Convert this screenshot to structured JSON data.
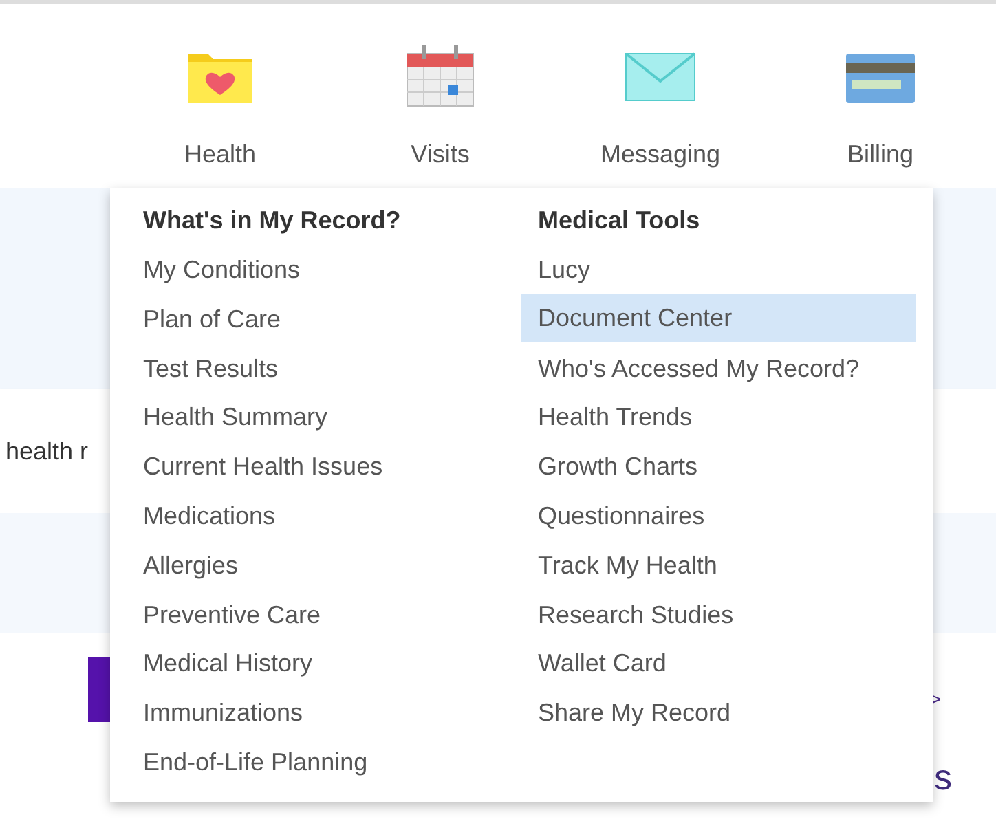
{
  "nav": [
    {
      "label": "Health"
    },
    {
      "label": "Visits"
    },
    {
      "label": "Messaging"
    },
    {
      "label": "Billing"
    }
  ],
  "background": {
    "card_text": "health r",
    "link_arrow": ">",
    "heading_end": "s"
  },
  "menu": {
    "columns": [
      {
        "heading": "What's in My Record?",
        "items": [
          {
            "label": "My Conditions",
            "selected": false
          },
          {
            "label": "Plan of Care",
            "selected": false
          },
          {
            "label": "Test Results",
            "selected": false
          },
          {
            "label": "Health Summary",
            "selected": false
          },
          {
            "label": "Current Health Issues",
            "selected": false
          },
          {
            "label": "Medications",
            "selected": false
          },
          {
            "label": "Allergies",
            "selected": false
          },
          {
            "label": "Preventive Care",
            "selected": false
          },
          {
            "label": "Medical History",
            "selected": false
          },
          {
            "label": "Immunizations",
            "selected": false
          },
          {
            "label": "End-of-Life Planning",
            "selected": false
          }
        ]
      },
      {
        "heading": "Medical Tools",
        "items": [
          {
            "label": "Lucy",
            "selected": false
          },
          {
            "label": "Document Center",
            "selected": true
          },
          {
            "label": "Who's Accessed My Record?",
            "selected": false
          },
          {
            "label": "Health Trends",
            "selected": false
          },
          {
            "label": "Growth Charts",
            "selected": false
          },
          {
            "label": "Questionnaires",
            "selected": false
          },
          {
            "label": "Track My Health",
            "selected": false
          },
          {
            "label": "Research Studies",
            "selected": false
          },
          {
            "label": "Wallet Card",
            "selected": false
          },
          {
            "label": "Share My Record",
            "selected": false
          }
        ]
      }
    ]
  }
}
